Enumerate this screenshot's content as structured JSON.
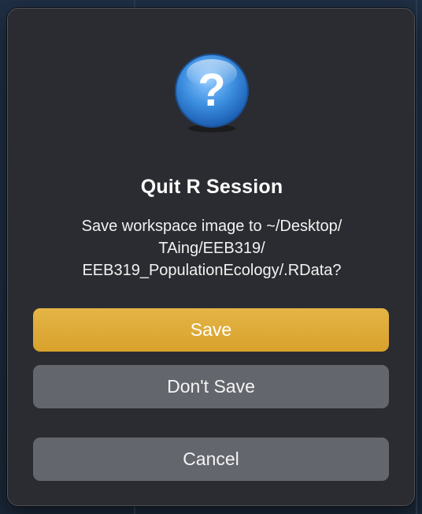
{
  "dialog": {
    "title": "Quit R Session",
    "message_lines": [
      "Save workspace image to ~/Desktop/",
      "TAing/EEB319/",
      "EEB319_PopulationEcology/.RData?"
    ],
    "icon": "question-mark-icon",
    "buttons": {
      "save": "Save",
      "dont_save": "Don't Save",
      "cancel": "Cancel"
    }
  },
  "colors": {
    "dialog_bg": "#2b2c31",
    "primary_button": "#dfaa35",
    "secondary_button": "#64666d",
    "icon_blue": "#3d8fe0"
  }
}
